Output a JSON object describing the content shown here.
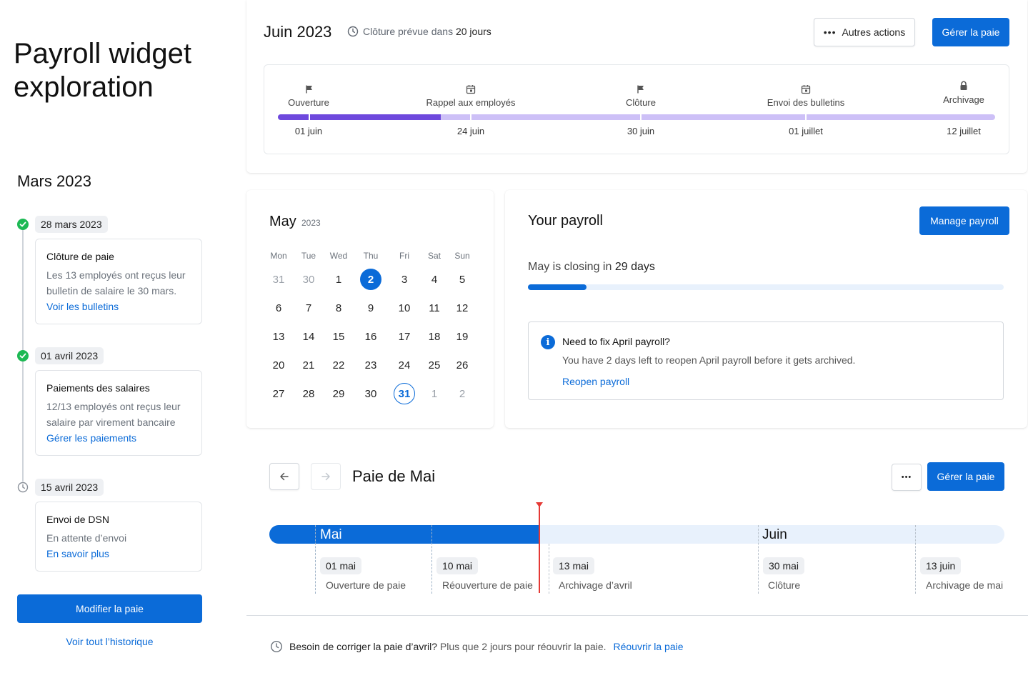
{
  "page_title_line1": "Payroll widget",
  "page_title_line2": "exploration",
  "history": {
    "title": "Mars 2023",
    "events": [
      {
        "date": "28 mars 2023",
        "title": "Clôture de paie",
        "desc": "Les 13 employés ont reçus leur bulletin de salaire le 30 mars.",
        "link": "Voir les bulletins",
        "status": "done"
      },
      {
        "date": "01 avril 2023",
        "title": "Paiements des salaires",
        "desc": "12/13 employés ont reçus leur salaire par virement bancaire",
        "link": "Gérer les paiements",
        "status": "done"
      },
      {
        "date": "15 avril 2023",
        "title": "Envoi de DSN",
        "desc": "En attente d’envoi",
        "link": "En savoir plus",
        "status": "pending"
      }
    ],
    "modify_button": "Modifier la paie",
    "history_link": "Voir tout l’historique"
  },
  "top": {
    "title": "Juin 2023",
    "closing_prefix": "Clôture prévue dans ",
    "closing_days": "20 jours",
    "more_actions": "Autres actions",
    "manage": "Gérer la paie",
    "progress": 0.227,
    "steps": [
      {
        "label": "Ouverture",
        "date": "01 juin",
        "icon": "flag-icon"
      },
      {
        "label": "Rappel aux employés",
        "date": "24 juin",
        "icon": "calendar-icon"
      },
      {
        "label": "Clôture",
        "date": "30 juin",
        "icon": "flag-icon"
      },
      {
        "label": "Envoi des bulletins",
        "date": "01 juillet",
        "icon": "calendar-icon"
      },
      {
        "label": "Archivage",
        "date": "12 juillet",
        "icon": "lock-icon"
      }
    ]
  },
  "calendar": {
    "month": "May",
    "year": "2023",
    "weekdays": [
      "Mon",
      "Tue",
      "Wed",
      "Thu",
      "Fri",
      "Sat",
      "Sun"
    ],
    "weeks": [
      [
        "31",
        "30",
        "1",
        "2",
        "3",
        "4",
        "5"
      ],
      [
        "6",
        "7",
        "8",
        "9",
        "10",
        "11",
        "12"
      ],
      [
        "13",
        "14",
        "15",
        "16",
        "17",
        "18",
        "19"
      ],
      [
        "20",
        "21",
        "22",
        "23",
        "24",
        "25",
        "26"
      ],
      [
        "27",
        "28",
        "29",
        "30",
        "31",
        "1",
        "2"
      ]
    ],
    "selected_day": "2",
    "today_day": "31"
  },
  "your_payroll": {
    "title": "Your payroll",
    "manage": "Manage payroll",
    "closing_prefix": "May is closing in ",
    "closing_days": "29 days",
    "progress": 0.123,
    "info": {
      "title": "Need to fix April payroll?",
      "text": "You have 2 days left to reopen April payroll before it gets archived.",
      "link": "Reopen payroll"
    }
  },
  "paie_mai": {
    "title": "Paie de Mai",
    "manage": "Gérer la paie",
    "months": [
      "Mai",
      "Juin"
    ],
    "milestones": [
      {
        "date": "01 mai",
        "label": "Ouverture de paie"
      },
      {
        "date": "10 mai",
        "label": "Réouverture de paie"
      },
      {
        "date": "13 mai",
        "label": "Archivage d’avril"
      },
      {
        "date": "30 mai",
        "label": "Clôture"
      },
      {
        "date": "13 juin",
        "label": "Archivage de mai"
      }
    ]
  },
  "footer": {
    "bold": "Besoin de corriger la paie d’avril?",
    "text": "Plus que 2 jours pour réouvrir la paie.",
    "link": "Réouvrir la paie"
  },
  "colors": {
    "accent": "#0b6bd8",
    "done": "#1db954",
    "progress_purple": "#6e49dd",
    "progress_purple_light": "#cdc0f7",
    "now_marker": "#e53935"
  }
}
